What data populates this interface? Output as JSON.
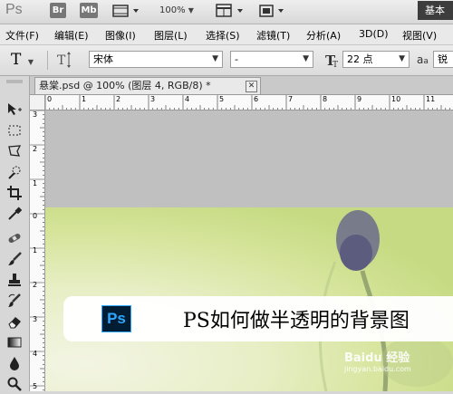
{
  "app": {
    "logo": "Ps",
    "bridge_label": "Br",
    "minibridge_label": "Mb",
    "zoom_level": "100%",
    "workspace_label": "基本"
  },
  "menu": [
    {
      "label": "文件(F)"
    },
    {
      "label": "编辑(E)"
    },
    {
      "label": "图像(I)"
    },
    {
      "label": "图层(L)"
    },
    {
      "label": "选择(S)"
    },
    {
      "label": "滤镜(T)"
    },
    {
      "label": "分析(A)"
    },
    {
      "label": "3D(D)"
    },
    {
      "label": "视图(V)"
    }
  ],
  "options": {
    "tool_glyph": "T",
    "font_family": "宋体",
    "font_style": "-",
    "font_size": "22 点",
    "aa_glyph": "a",
    "aa_mode": "锐"
  },
  "document": {
    "tab_title": "悬棠.psd @ 100% (图层 4, RGB/8) *",
    "close_glyph": "✕"
  },
  "rulers": {
    "h_labels": [
      "0",
      "1",
      "2",
      "3",
      "4",
      "5",
      "6",
      "7",
      "8",
      "9",
      "10",
      "11"
    ],
    "v_labels": [
      "3",
      "2",
      "1",
      "0",
      "1",
      "2",
      "3",
      "4",
      "5"
    ]
  },
  "canvas": {
    "banner_badge": "Ps",
    "banner_title": "PS如何做半透明的背景图",
    "watermark_text": "Baidu 经验",
    "watermark_url": "jingyan.baidu.com"
  },
  "colors": {
    "ps_badge_bg": "#001d34",
    "ps_badge_fg": "#31a8ff",
    "canvas_gray": "#c0c0c0",
    "photo_green": "#d5e49a"
  }
}
